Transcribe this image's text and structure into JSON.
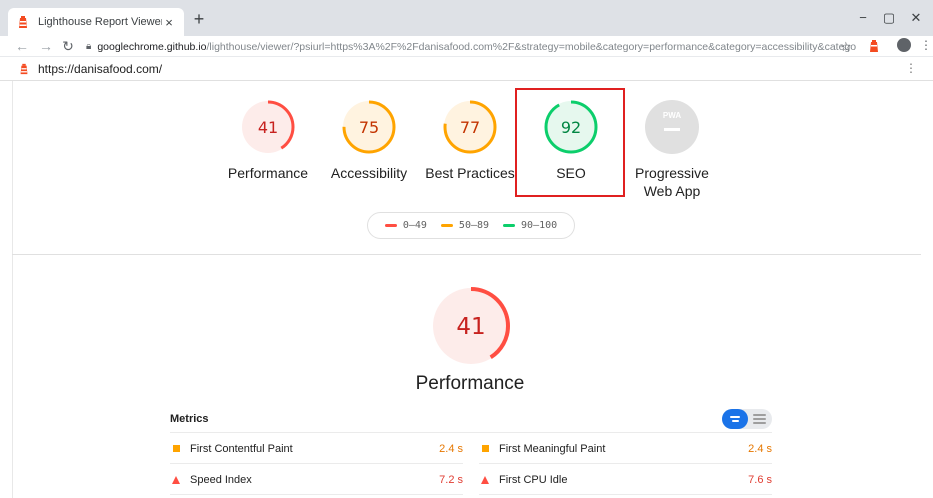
{
  "browser": {
    "tab_title": "Lighthouse Report Viewer",
    "tab_close": "×",
    "new_tab": "+",
    "minimize": "−",
    "restore": "▢",
    "close": "✕",
    "url_host": "googlechrome.github.io",
    "url_path": "/lighthouse/viewer/?psiurl=https%3A%2F%2Fdanisafood.com%2F&strategy=mobile&category=performance&category=accessibility&category=b...",
    "star": "☆",
    "menu": "⋮"
  },
  "report": {
    "url": "https://danisafood.com/",
    "menu": "⋮"
  },
  "gauges": [
    {
      "label": "Performance",
      "score": "41",
      "value": 41,
      "color": "#ff4e42",
      "bg": "#fdecea"
    },
    {
      "label": "Accessibility",
      "score": "75",
      "value": 75,
      "color": "#ffa400",
      "bg": "#fff3e0"
    },
    {
      "label": "Best Practices",
      "score": "77",
      "value": 77,
      "color": "#ffa400",
      "bg": "#fff3e0"
    },
    {
      "label": "SEO",
      "score": "92",
      "value": 92,
      "color": "#0cce6b",
      "bg": "#e6f8ee"
    }
  ],
  "pwa": {
    "label_line1": "Progressive",
    "label_line2": "Web App",
    "badge": "PWA"
  },
  "legend": [
    {
      "label": "0–49",
      "color": "#ff4e42"
    },
    {
      "label": "50–89",
      "color": "#ffa400"
    },
    {
      "label": "90–100",
      "color": "#0cce6b"
    }
  ],
  "performance": {
    "score": "41",
    "value": 41,
    "title": "Performance",
    "color": "#ff4e42",
    "bg": "#fdecea"
  },
  "metrics": {
    "title": "Metrics",
    "items": [
      {
        "name": "First Contentful Paint",
        "value": "2.4 s",
        "rating": "average"
      },
      {
        "name": "First Meaningful Paint",
        "value": "2.4 s",
        "rating": "average"
      },
      {
        "name": "Speed Index",
        "value": "7.2 s",
        "rating": "fail"
      },
      {
        "name": "First CPU Idle",
        "value": "7.6 s",
        "rating": "fail"
      }
    ]
  }
}
